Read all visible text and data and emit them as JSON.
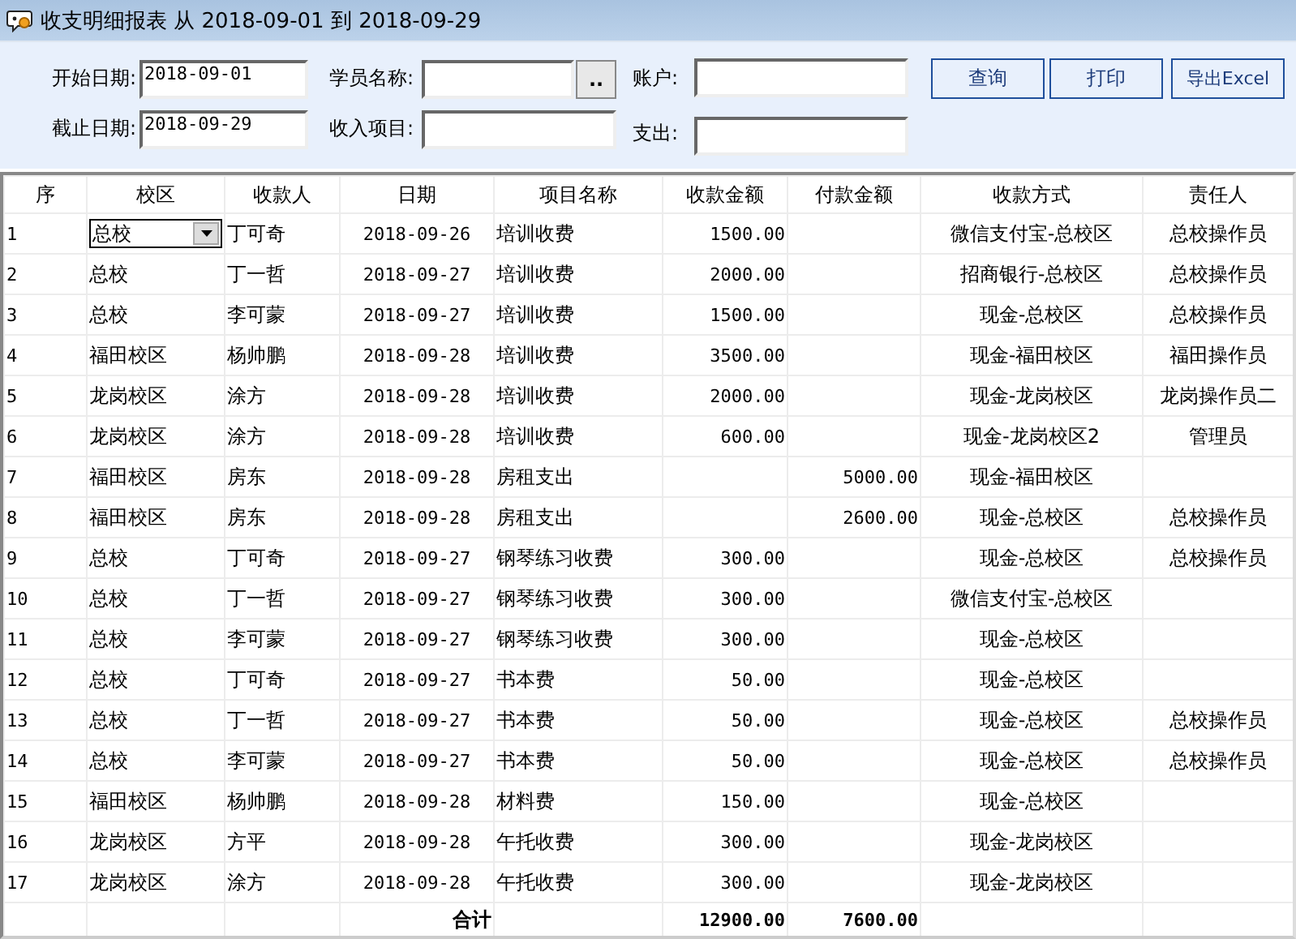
{
  "window": {
    "title": "收支明细报表 从 2018-09-01 到 2018-09-29"
  },
  "filters": {
    "rows": [
      [
        {
          "kind": "field",
          "label": "开始日期:",
          "value": "2018-09-01"
        },
        {
          "kind": "picker",
          "label": "学员名称:",
          "button": ".."
        },
        {
          "kind": "field",
          "label": "账户:"
        }
      ],
      [
        {
          "kind": "field",
          "label": "截止日期:",
          "value": "2018-09-29"
        },
        {
          "kind": "field",
          "label": "收入项目:"
        },
        {
          "kind": "field",
          "label": "支出:"
        }
      ]
    ],
    "buttons": [
      "查询",
      "打印",
      "导出Excel"
    ]
  },
  "table": {
    "columns": [
      "序",
      "校区",
      "收款人",
      "日期",
      "项目名称",
      "收款金额",
      "付款金额",
      "收款方式",
      "责任人"
    ],
    "rows": [
      {
        "no": "1",
        "campus": "总校",
        "payee": "丁可奇",
        "date": "2018-09-26",
        "item": "培训收费",
        "income": "1500.00",
        "method": "微信支付宝-总校区",
        "person": "总校操作员",
        "dropdown": true
      },
      {
        "no": "2",
        "campus": "总校",
        "payee": "丁一哲",
        "date": "2018-09-27",
        "item": "培训收费",
        "income": "2000.00",
        "method": "招商银行-总校区",
        "person": "总校操作员",
        "dropdown": false
      },
      {
        "no": "3",
        "campus": "总校",
        "payee": "李可蒙",
        "date": "2018-09-27",
        "item": "培训收费",
        "income": "1500.00",
        "method": "现金-总校区",
        "person": "总校操作员",
        "dropdown": false
      },
      {
        "no": "4",
        "campus": "福田校区",
        "payee": "杨帅鹏",
        "date": "2018-09-28",
        "item": "培训收费",
        "income": "3500.00",
        "method": "现金-福田校区",
        "person": "福田操作员",
        "dropdown": false
      },
      {
        "no": "5",
        "campus": "龙岗校区",
        "payee": "涂方",
        "date": "2018-09-28",
        "item": "培训收费",
        "income": "2000.00",
        "method": "现金-龙岗校区",
        "person": "龙岗操作员二",
        "dropdown": false
      },
      {
        "no": "6",
        "campus": "龙岗校区",
        "payee": "涂方",
        "date": "2018-09-28",
        "item": "培训收费",
        "income": "600.00",
        "method": "现金-龙岗校区2",
        "person": "管理员",
        "dropdown": false
      },
      {
        "no": "7",
        "campus": "福田校区",
        "payee": "房东",
        "date": "2018-09-28",
        "item": "房租支出",
        "expense": "5000.00",
        "method": "现金-福田校区",
        "dropdown": false
      },
      {
        "no": "8",
        "campus": "福田校区",
        "payee": "房东",
        "date": "2018-09-28",
        "item": "房租支出",
        "expense": "2600.00",
        "method": "现金-总校区",
        "person": "总校操作员",
        "dropdown": false
      },
      {
        "no": "9",
        "campus": "总校",
        "payee": "丁可奇",
        "date": "2018-09-27",
        "item": "钢琴练习收费",
        "income": "300.00",
        "method": "现金-总校区",
        "person": "总校操作员",
        "dropdown": false
      },
      {
        "no": "10",
        "campus": "总校",
        "payee": "丁一哲",
        "date": "2018-09-27",
        "item": "钢琴练习收费",
        "income": "300.00",
        "method": "微信支付宝-总校区",
        "dropdown": false
      },
      {
        "no": "11",
        "campus": "总校",
        "payee": "李可蒙",
        "date": "2018-09-27",
        "item": "钢琴练习收费",
        "income": "300.00",
        "method": "现金-总校区",
        "dropdown": false
      },
      {
        "no": "12",
        "campus": "总校",
        "payee": "丁可奇",
        "date": "2018-09-27",
        "item": "书本费",
        "income": "50.00",
        "method": "现金-总校区",
        "dropdown": false
      },
      {
        "no": "13",
        "campus": "总校",
        "payee": "丁一哲",
        "date": "2018-09-27",
        "item": "书本费",
        "income": "50.00",
        "method": "现金-总校区",
        "person": "总校操作员",
        "dropdown": false
      },
      {
        "no": "14",
        "campus": "总校",
        "payee": "李可蒙",
        "date": "2018-09-27",
        "item": "书本费",
        "income": "50.00",
        "method": "现金-总校区",
        "person": "总校操作员",
        "dropdown": false
      },
      {
        "no": "15",
        "campus": "福田校区",
        "payee": "杨帅鹏",
        "date": "2018-09-28",
        "item": "材料费",
        "income": "150.00",
        "method": "现金-总校区",
        "dropdown": false
      },
      {
        "no": "16",
        "campus": "龙岗校区",
        "payee": "方平",
        "date": "2018-09-28",
        "item": "午托收费",
        "income": "300.00",
        "method": "现金-龙岗校区",
        "dropdown": false
      },
      {
        "no": "17",
        "campus": "龙岗校区",
        "payee": "涂方",
        "date": "2018-09-28",
        "item": "午托收费",
        "income": "300.00",
        "method": "现金-龙岗校区",
        "dropdown": false
      }
    ],
    "total": {
      "label": "合计",
      "income": "12900.00",
      "expense": "7600.00"
    }
  }
}
